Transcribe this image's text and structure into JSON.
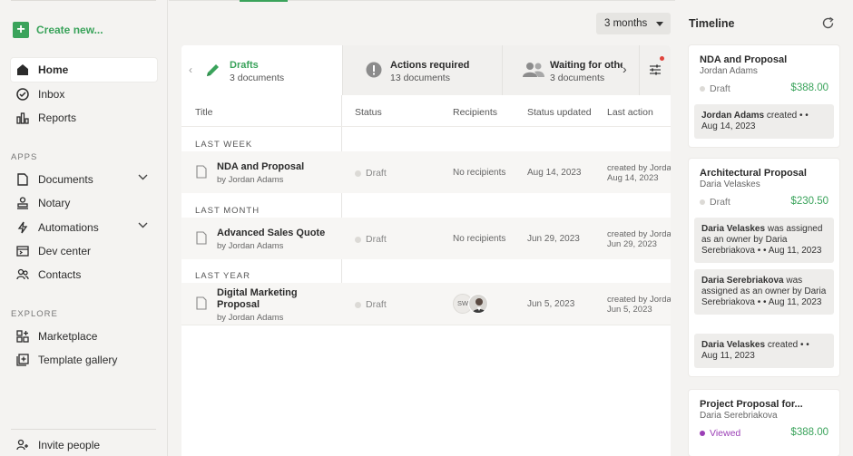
{
  "sidebar": {
    "create_label": "Create new...",
    "items_top": [
      {
        "label": "Home",
        "icon": "home-icon"
      },
      {
        "label": "Inbox",
        "icon": "inbox-check-icon"
      },
      {
        "label": "Reports",
        "icon": "bar-chart-icon"
      }
    ],
    "apps_label": "APPS",
    "apps": [
      {
        "label": "Documents",
        "icon": "document-icon"
      },
      {
        "label": "Notary",
        "icon": "stamp-icon"
      },
      {
        "label": "Automations",
        "icon": "bolt-icon"
      },
      {
        "label": "Dev center",
        "icon": "terminal-icon"
      },
      {
        "label": "Contacts",
        "icon": "contacts-icon"
      }
    ],
    "explore_label": "EXPLORE",
    "explore": [
      {
        "label": "Marketplace",
        "icon": "grid-icon"
      },
      {
        "label": "Template gallery",
        "icon": "template-icon"
      }
    ],
    "invite_label": "Invite people"
  },
  "filter": {
    "period": "3 months"
  },
  "tabs": [
    {
      "name": "Drafts",
      "count": "3 documents"
    },
    {
      "name": "Actions required",
      "count": "13 documents"
    },
    {
      "name": "Waiting for others",
      "count": "3 documents"
    }
  ],
  "columns": {
    "title": "Title",
    "status": "Status",
    "recipients": "Recipients",
    "updated": "Status updated",
    "last_action": "Last action"
  },
  "groups": [
    {
      "label": "LAST WEEK",
      "doc": {
        "title": "NDA and Proposal",
        "by": "by Jordan Adams",
        "status": "Draft",
        "recipients": "No recipients",
        "updated": "Aug 14, 2023",
        "last_action_1": "created by Jordan Adams",
        "last_action_2": "Aug 14, 2023"
      }
    },
    {
      "label": "LAST MONTH",
      "doc": {
        "title": "Advanced Sales Quote",
        "by": "by Jordan Adams",
        "status": "Draft",
        "recipients": "No recipients",
        "updated": "Jun 29, 2023",
        "last_action_1": "created by Jordan Adams",
        "last_action_2": "Jun 29, 2023"
      }
    },
    {
      "label": "LAST YEAR",
      "doc": {
        "title": "Digital Marketing Proposal",
        "by": "by Jordan Adams",
        "status": "Draft",
        "recipient_initials": "SW",
        "updated": "Jun 5, 2023",
        "last_action_1": "created by Jordan Adams",
        "last_action_2": "Jun 5, 2023"
      }
    }
  ],
  "timeline": {
    "title": "Timeline",
    "cards": [
      {
        "title": "NDA and Proposal",
        "owner": "Jordan Adams",
        "status": "Draft",
        "amount": "$388.00",
        "events": [
          {
            "who": "Jordan Adams",
            "text": " created • •",
            "date": "Aug 14, 2023"
          }
        ]
      },
      {
        "title": "Architectural Proposal",
        "owner": "Daria Velaskes",
        "status": "Draft",
        "amount": "$230.50",
        "events": [
          {
            "who": "Daria Velaskes",
            "text": " was assigned as an owner by Daria Serebriakova • • Aug 11, 2023"
          },
          {
            "who": "Daria Serebriakova",
            "text": " was assigned as an owner by Daria Serebriakova • • Aug 11, 2023"
          },
          {
            "who": "Daria Velaskes",
            "text": " created • •",
            "date": "Aug 11, 2023"
          }
        ]
      },
      {
        "title": "Project Proposal for...",
        "owner": "Daria Serebriakova",
        "status": "Viewed",
        "amount": "$388.00",
        "events": []
      }
    ]
  },
  "colors": {
    "accent": "#3aa35b",
    "viewed": "#9b3fb6",
    "alert": "#e0443c"
  }
}
